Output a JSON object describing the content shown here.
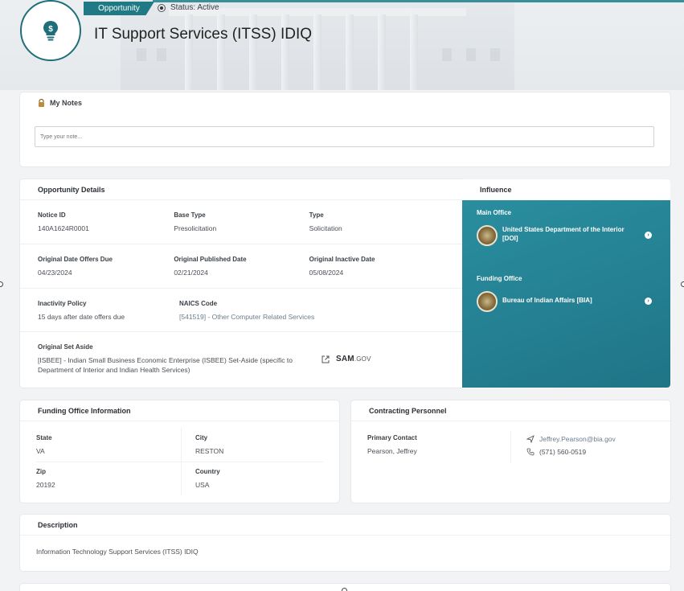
{
  "header": {
    "type_chip": "Opportunity",
    "status": "Status: Active",
    "title": "IT Support Services (ITSS) IDIQ",
    "icon": "lightbulb-dollar-icon"
  },
  "notes": {
    "title": "My Notes",
    "placeholder": "Type your note...",
    "icon": "lock-icon"
  },
  "details": {
    "title": "Opportunity Details",
    "notice_id_label": "Notice ID",
    "notice_id": "140A1624R0001",
    "base_type_label": "Base Type",
    "base_type": "Presolicitation",
    "type_label": "Type",
    "type": "Solicitation",
    "offers_due_label": "Original Date Offers Due",
    "offers_due": "04/23/2024",
    "published_label": "Original Published Date",
    "published": "02/21/2024",
    "inactive_label": "Original Inactive Date",
    "inactive": "05/08/2024",
    "inactivity_policy_label": "Inactivity Policy",
    "inactivity_policy": "15 days after date offers due",
    "naics_label": "NAICS Code",
    "naics": "[541519] - Other Computer Related Services",
    "set_aside_label": "Original Set Aside",
    "set_aside": "[ISBEE] - Indian Small Business Economic Enterprise (ISBEE) Set-Aside (specific to Department of Interior and Indian Health Services)",
    "sam_logo": "SAM",
    "sam_logo_suffix": ".GOV"
  },
  "influence": {
    "title": "Influence",
    "main_office_label": "Main Office",
    "main_office": "United States Department of the Interior [DOI]",
    "funding_office_label": "Funding Office",
    "funding_office": "Bureau of Indian Affairs [BIA]"
  },
  "funding_info": {
    "title": "Funding Office Information",
    "state_label": "State",
    "state": "VA",
    "city_label": "City",
    "city": "RESTON",
    "zip_label": "Zip",
    "zip": "20192",
    "country_label": "Country",
    "country": "USA"
  },
  "contracting": {
    "title": "Contracting Personnel",
    "primary_contact_label": "Primary Contact",
    "primary_contact": "Pearson, Jeffrey",
    "email": "Jeffrey.Pearson@bia.gov",
    "phone": "(571) 560-0519"
  },
  "description": {
    "title": "Description",
    "text": "Information Technology Support Services (ITSS) IDIQ"
  },
  "colors": {
    "accent": "#1f7a86",
    "influence_bg": "#2a8e9f"
  }
}
